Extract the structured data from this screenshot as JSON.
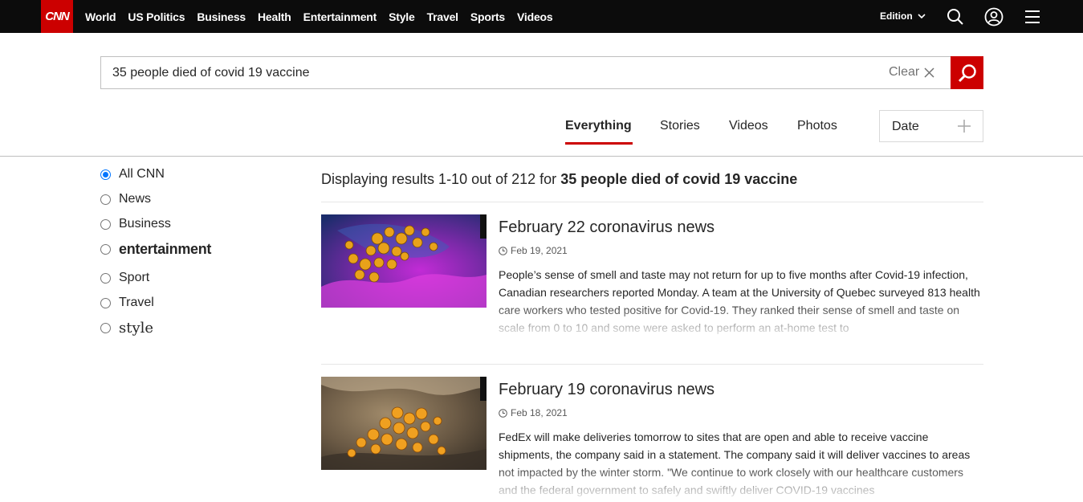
{
  "nav": {
    "logo": "CNN",
    "links": [
      "World",
      "US Politics",
      "Business",
      "Health",
      "Entertainment",
      "Style",
      "Travel",
      "Sports",
      "Videos"
    ],
    "edition": "Edition"
  },
  "search": {
    "query": "35 people died of covid 19 vaccine",
    "clear_label": "Clear"
  },
  "tabs": [
    {
      "label": "Everything",
      "active": true
    },
    {
      "label": "Stories",
      "active": false
    },
    {
      "label": "Videos",
      "active": false
    },
    {
      "label": "Photos",
      "active": false
    }
  ],
  "date_filter": {
    "label": "Date"
  },
  "filters": [
    {
      "label": "All CNN",
      "checked": true
    },
    {
      "label": "News",
      "checked": false
    },
    {
      "label": "Business",
      "checked": false
    },
    {
      "label": "entertainment",
      "checked": false
    },
    {
      "label": "Sport",
      "checked": false
    },
    {
      "label": "Travel",
      "checked": false
    },
    {
      "label": "style",
      "checked": false
    }
  ],
  "results_summary": {
    "prefix": "Displaying results 1-10 out of 212 for",
    "query": "35 people died of covid 19 vaccine"
  },
  "results": [
    {
      "title": "February 22 coronavirus news",
      "date": "Feb 19, 2021",
      "snippet": "People’s sense of smell and taste may not return for up to five months after Covid-19 infection, Canadian researchers reported Monday. A team at the University of Quebec surveyed 813 health care workers who tested positive for Covid-19. They ranked their sense of smell and taste on scale from 0 to 10 and some were asked to perform an at-home test to"
    },
    {
      "title": "February 19 coronavirus news",
      "date": "Feb 18, 2021",
      "snippet": "FedEx will make deliveries tomorrow to sites that are open and able to receive vaccine shipments, the company said in a statement. The company said it will deliver vaccines to areas not impacted by the winter storm. \"We continue to work closely with our healthcare customers and the federal government to safely and swiftly deliver COVID-19 vaccines"
    }
  ],
  "colors": {
    "brand_red": "#cc0000",
    "nav_bg": "#0c0c0c",
    "radio_blue": "#0075ff"
  }
}
